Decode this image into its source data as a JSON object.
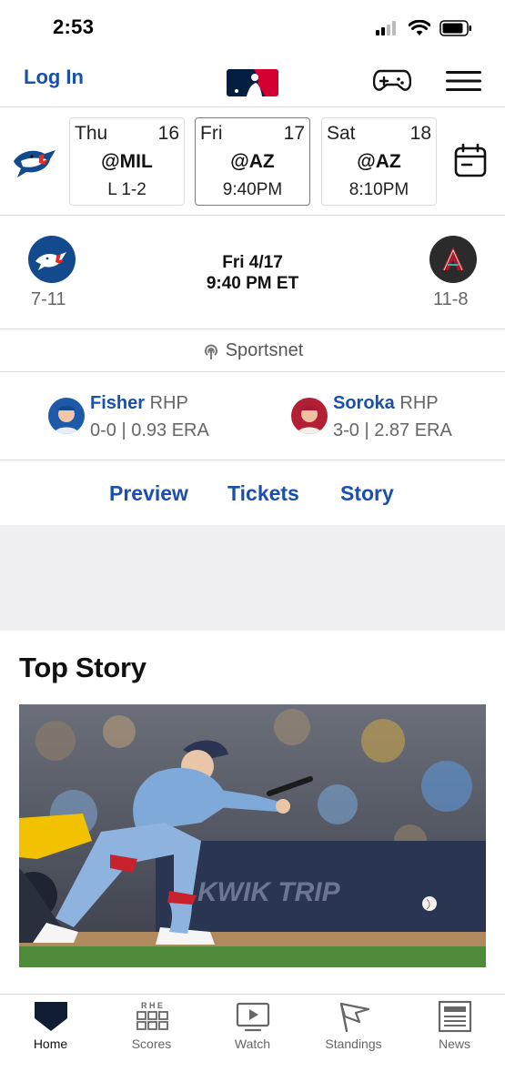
{
  "status_bar": {
    "time": "2:53"
  },
  "header": {
    "login_label": "Log In"
  },
  "schedule": {
    "games": [
      {
        "day": "Thu",
        "date": "16",
        "opponent": "@MIL",
        "result": "L 1-2",
        "selected": false
      },
      {
        "day": "Fri",
        "date": "17",
        "opponent": "@AZ",
        "result": "9:40PM",
        "selected": true
      },
      {
        "day": "Sat",
        "date": "18",
        "opponent": "@AZ",
        "result": "8:10PM",
        "selected": false
      }
    ]
  },
  "matchup": {
    "away_record": "7-11",
    "home_record": "11-8",
    "date": "Fri 4/17",
    "time": "9:40 PM ET"
  },
  "broadcast": {
    "network": "Sportsnet"
  },
  "pitchers": {
    "away": {
      "name": "Fisher",
      "position": "RHP",
      "stats": "0-0 | 0.93 ERA"
    },
    "home": {
      "name": "Soroka",
      "position": "RHP",
      "stats": "3-0 | 2.87 ERA"
    }
  },
  "game_links": {
    "preview": "Preview",
    "tickets": "Tickets",
    "story": "Story"
  },
  "top_story": {
    "title": "Top Story",
    "image_text": "KWIK TRIP"
  },
  "tab_bar": {
    "tabs": [
      {
        "label": "Home",
        "icon": "home-plate-icon",
        "active": true
      },
      {
        "label": "Scores",
        "icon": "scores-grid-icon",
        "active": false
      },
      {
        "label": "Watch",
        "icon": "watch-play-icon",
        "active": false
      },
      {
        "label": "Standings",
        "icon": "standings-flag-icon",
        "active": false
      },
      {
        "label": "News",
        "icon": "news-icon",
        "active": false
      }
    ]
  },
  "colors": {
    "link_blue": "#1a4fad",
    "bluejays_blue": "#134a8e",
    "dbacks_red": "#a71930",
    "mlb_red": "#d50032"
  }
}
